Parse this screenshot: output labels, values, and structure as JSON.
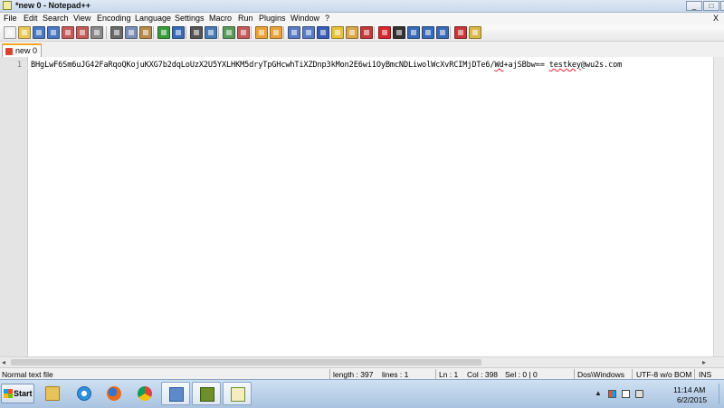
{
  "window": {
    "title": "*new  0 - Notepad++",
    "min_label": "_",
    "max_label": "□"
  },
  "menu": {
    "items": [
      "File",
      "Edit",
      "Search",
      "View",
      "Encoding",
      "Language",
      "Settings",
      "Macro",
      "Run",
      "Plugins",
      "Window",
      "?"
    ],
    "close_label": "X"
  },
  "toolbar": {
    "buttons": [
      {
        "icon": "new-file-icon",
        "color": "#f1f1f1"
      },
      {
        "icon": "open-file-icon",
        "color": "#e9c85a"
      },
      {
        "icon": "save-icon",
        "color": "#4a78c2"
      },
      {
        "icon": "save-all-icon",
        "color": "#4a78c2"
      },
      {
        "icon": "close-file-icon",
        "color": "#c45a5a"
      },
      {
        "icon": "close-all-icon",
        "color": "#c45a5a"
      },
      {
        "icon": "print-icon",
        "color": "#8a8a8a"
      },
      {
        "icon": "cut-icon",
        "color": "#6a6a6a"
      },
      {
        "icon": "copy-icon",
        "color": "#7a8fb5"
      },
      {
        "icon": "paste-icon",
        "color": "#b58a4a"
      },
      {
        "icon": "undo-icon",
        "color": "#3a9a3a"
      },
      {
        "icon": "redo-icon",
        "color": "#3a6ab5"
      },
      {
        "icon": "find-icon",
        "color": "#555555"
      },
      {
        "icon": "replace-icon",
        "color": "#4a7ab5"
      },
      {
        "icon": "zoom-in-icon",
        "color": "#5a9a5a"
      },
      {
        "icon": "zoom-out-icon",
        "color": "#c55a5a"
      },
      {
        "icon": "sync-vertical-icon",
        "color": "#e8a23a"
      },
      {
        "icon": "sync-horizontal-icon",
        "color": "#e8a23a"
      },
      {
        "icon": "word-wrap-icon",
        "color": "#5a7ac2"
      },
      {
        "icon": "show-all-chars-icon",
        "color": "#5a7ac2"
      },
      {
        "icon": "indent-guide-icon",
        "color": "#3a5ab5"
      },
      {
        "icon": "user-language-icon",
        "color": "#e8c23a"
      },
      {
        "icon": "doc-map-icon",
        "color": "#d9a64a"
      },
      {
        "icon": "function-list-icon",
        "color": "#c23a3a"
      },
      {
        "icon": "record-macro-icon",
        "color": "#d8262b"
      },
      {
        "icon": "stop-macro-icon",
        "color": "#333333"
      },
      {
        "icon": "play-macro-icon",
        "color": "#3a6ab5"
      },
      {
        "icon": "run-macro-multiple-icon",
        "color": "#3a6ab5"
      },
      {
        "icon": "save-macro-icon",
        "color": "#3a6ab5"
      },
      {
        "icon": "spell-check-icon",
        "color": "#c43a3a"
      },
      {
        "icon": "plugin-icon",
        "color": "#d9b84a"
      }
    ]
  },
  "tab": {
    "label": "new  0"
  },
  "editor": {
    "line_number": "1",
    "text_main": "BHgLwF6Sm6uJG42FaRqoQKojuKXG7b2dqLoUzX2U5YXLHKM5dryTpGHcwhTiXZDnp3kMon2E6wi1OyBmcNDLiwolWcXvRCIMjDTe6/",
    "text_sq1": "Wd",
    "text_mid": "+ajSBbw== ",
    "text_sq2": "testkey",
    "text_tail": "@wu2s.com"
  },
  "scroll": {
    "left_arrow": "◂",
    "right_arrow": "▸"
  },
  "status": {
    "file_type": "Normal text file",
    "length": "length : 397",
    "lines": "lines : 1",
    "ln": "Ln : 1",
    "col": "Col : 398",
    "sel": "Sel : 0 | 0",
    "eol": "Dos\\Windows",
    "encoding": "UTF-8 w/o BOM",
    "mode": "INS"
  },
  "taskbar": {
    "start_label": "Start",
    "apps": [
      {
        "name": "explorer",
        "icon": "folder-icon"
      },
      {
        "name": "internet-explorer",
        "icon": "internet-explorer-icon"
      },
      {
        "name": "firefox",
        "icon": "firefox-icon"
      },
      {
        "name": "chrome",
        "icon": "chrome-icon"
      },
      {
        "name": "remote-desktop",
        "icon": "remote-desktop-icon"
      },
      {
        "name": "putty",
        "icon": "putty-icon"
      },
      {
        "name": "notepad-plus-plus",
        "icon": "notepad-plus-plus-icon"
      }
    ],
    "tray_chevron": "▲",
    "clock_time": "11:14 AM",
    "clock_date": "6/2/2015"
  }
}
